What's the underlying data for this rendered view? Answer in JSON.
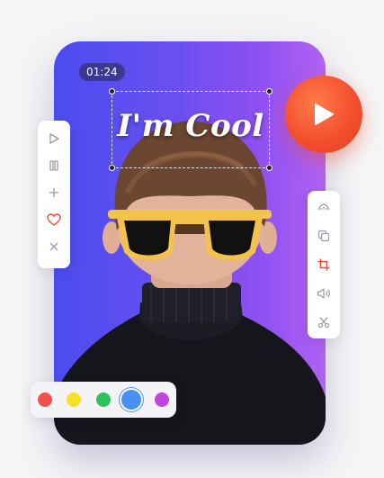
{
  "player": {
    "timestamp": "01:24",
    "overlay_text": "I'm Cool"
  },
  "play_button": {
    "icon": "play-icon",
    "color": "#f4502f"
  },
  "toolbar_left": [
    {
      "icon": "play-icon"
    },
    {
      "icon": "pause-icon"
    },
    {
      "icon": "plus-icon"
    },
    {
      "icon": "heart-icon",
      "color": "#e8503a"
    },
    {
      "icon": "close-icon"
    }
  ],
  "toolbar_right": [
    {
      "icon": "effects-icon"
    },
    {
      "icon": "copy-icon"
    },
    {
      "icon": "crop-icon",
      "color": "#e8503a"
    },
    {
      "icon": "volume-icon"
    },
    {
      "icon": "scissors-icon"
    }
  ],
  "palette": {
    "colors": [
      "#f2524a",
      "#f7e02a",
      "#2ec35a",
      "#4a8ff2",
      "#c444e0"
    ],
    "selected_index": 3
  }
}
